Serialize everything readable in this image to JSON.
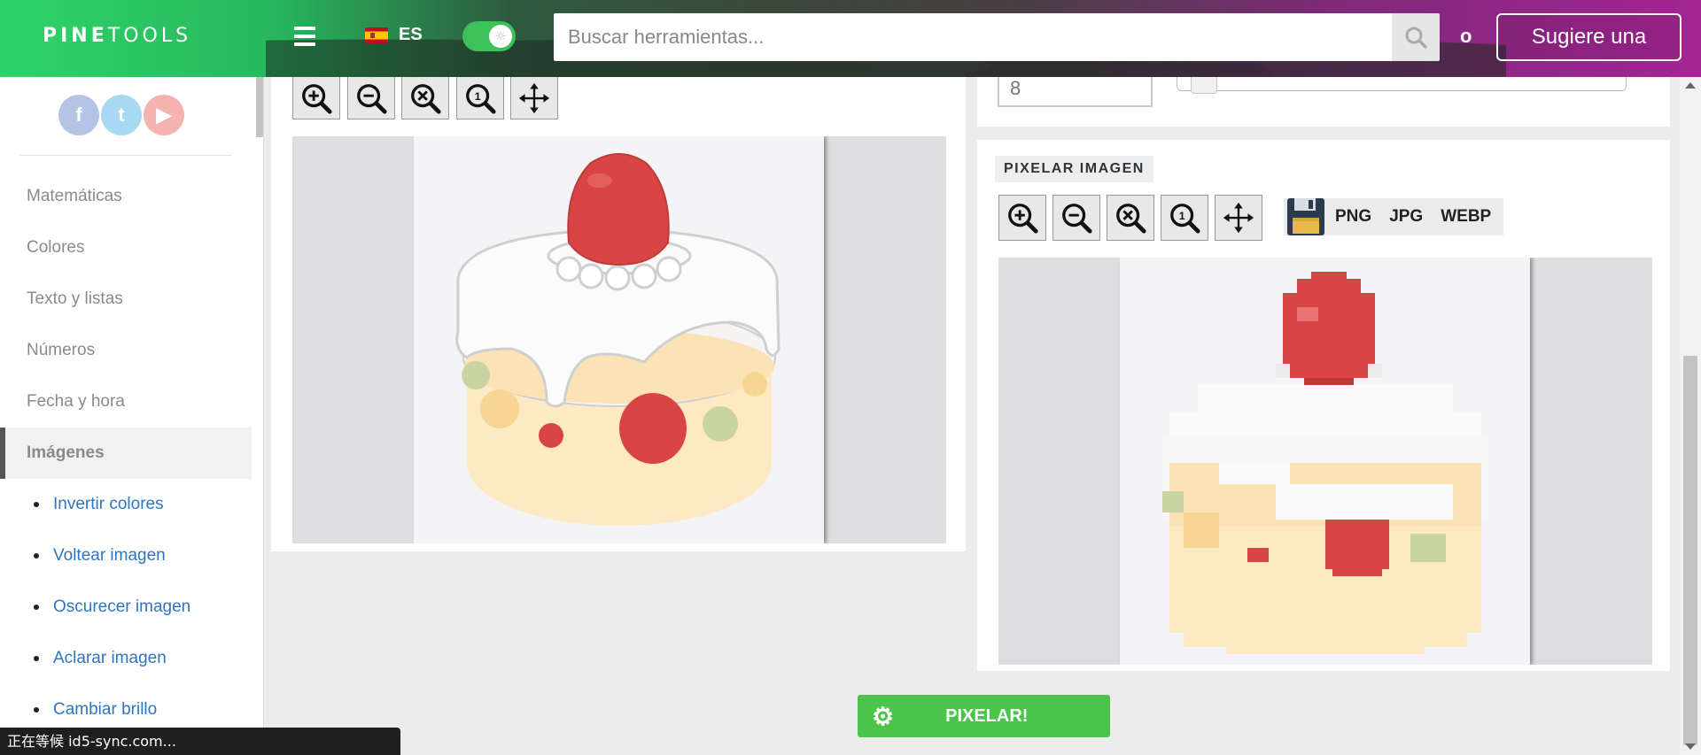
{
  "header": {
    "logo_bold": "PINE",
    "logo_thin": "TOOLS",
    "language": "ES",
    "search_placeholder": "Buscar herramientas...",
    "o_label": "o",
    "suggest_label": "Sugiere una"
  },
  "sidebar": {
    "social": [
      "f",
      "t",
      "▶"
    ],
    "menu": [
      {
        "label": "Matemáticas",
        "active": false
      },
      {
        "label": "Colores",
        "active": false
      },
      {
        "label": "Texto y listas",
        "active": false
      },
      {
        "label": "Números",
        "active": false
      },
      {
        "label": "Fecha y hora",
        "active": false
      },
      {
        "label": "Imágenes",
        "active": true
      }
    ],
    "submenu": [
      "Invertir colores",
      "Voltear imagen",
      "Oscurecer imagen",
      "Aclarar imagen",
      "Cambiar brillo"
    ]
  },
  "controls": {
    "pixel_size_value": "8",
    "slider_level": 0.03
  },
  "output": {
    "title": "PIXELAR IMAGEN",
    "formats": [
      "PNG",
      "JPG",
      "WEBP"
    ]
  },
  "action": {
    "pixelar_label": "PIXELAR!"
  },
  "status_text": "正在等候 id5-sync.com...",
  "colors": {
    "accent_green": "#4cc44c",
    "link_blue": "#2f74c0",
    "strawberry_red": "#d94545"
  }
}
